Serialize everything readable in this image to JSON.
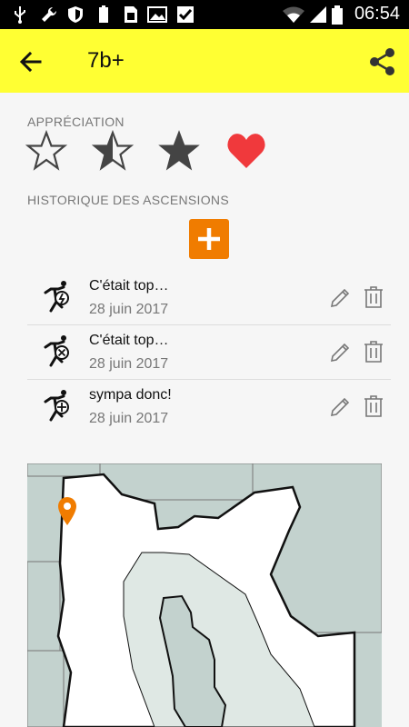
{
  "status_bar": {
    "time": "06:54",
    "icons": [
      "usb-icon",
      "wrench-icon",
      "shield-icon",
      "battery-saver-icon",
      "sim-icon",
      "image-icon",
      "check-icon",
      "wifi-icon",
      "signal-icon",
      "battery-icon"
    ]
  },
  "app_bar": {
    "title": "7b+",
    "back_icon": "arrow-back-icon",
    "share_icon": "share-icon",
    "color": "#ffff33"
  },
  "rating": {
    "label": "APPRÉCIATION",
    "options": [
      {
        "icon": "star-empty-icon"
      },
      {
        "icon": "star-half-icon"
      },
      {
        "icon": "star-full-icon"
      },
      {
        "icon": "heart-icon",
        "selected": true,
        "color": "#f0393c"
      }
    ]
  },
  "history": {
    "label": "HISTORIQUE DES ASCENSIONS",
    "add_icon": "plus-icon",
    "add_color": "#f07c00",
    "ascents": [
      {
        "icon": "climber-flash-icon",
        "comment": "C'était top…",
        "date": "28 juin 2017"
      },
      {
        "icon": "climber-fail-icon",
        "comment": "C'était top…",
        "date": "28 juin 2017"
      },
      {
        "icon": "climber-plus-icon",
        "comment": "sympa donc!",
        "date": "28 juin 2017"
      }
    ],
    "edit_icon": "pencil-icon",
    "delete_icon": "trash-icon"
  },
  "map": {
    "marker_icon": "location-pin-icon",
    "marker_color": "#f07c00"
  }
}
